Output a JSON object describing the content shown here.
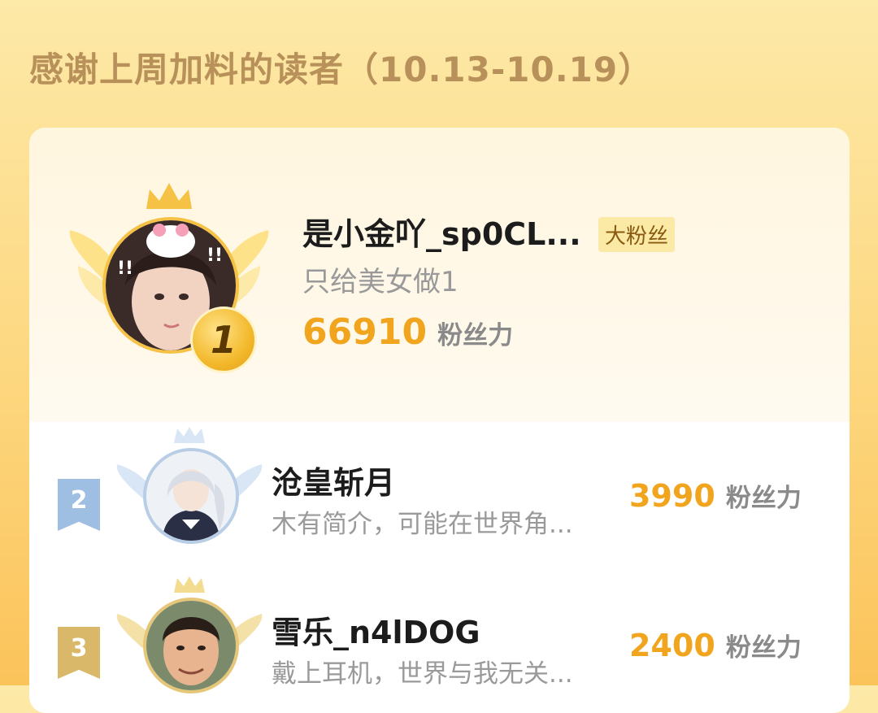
{
  "header": {
    "title": "感谢上周加料的读者（10.13-10.19）"
  },
  "colors": {
    "gold": "#f1a51f",
    "silver": "#9fbfe2",
    "bronze": "#d9b869",
    "title": "#b8915a"
  },
  "ranking": {
    "first": {
      "rank": "1",
      "name": "是小金吖_sp0CL...",
      "tag": "大粉丝",
      "bio": "只给美女做1",
      "score": "66910",
      "score_unit": "粉丝力"
    },
    "rows": [
      {
        "rank": "2",
        "name": "沧皇斩月",
        "bio": "木有简介，可能在世界角...",
        "score": "3990",
        "score_unit": "粉丝力"
      },
      {
        "rank": "3",
        "name": "雪乐_n4lDOG",
        "bio": "戴上耳机，世界与我无关...",
        "score": "2400",
        "score_unit": "粉丝力"
      }
    ]
  }
}
